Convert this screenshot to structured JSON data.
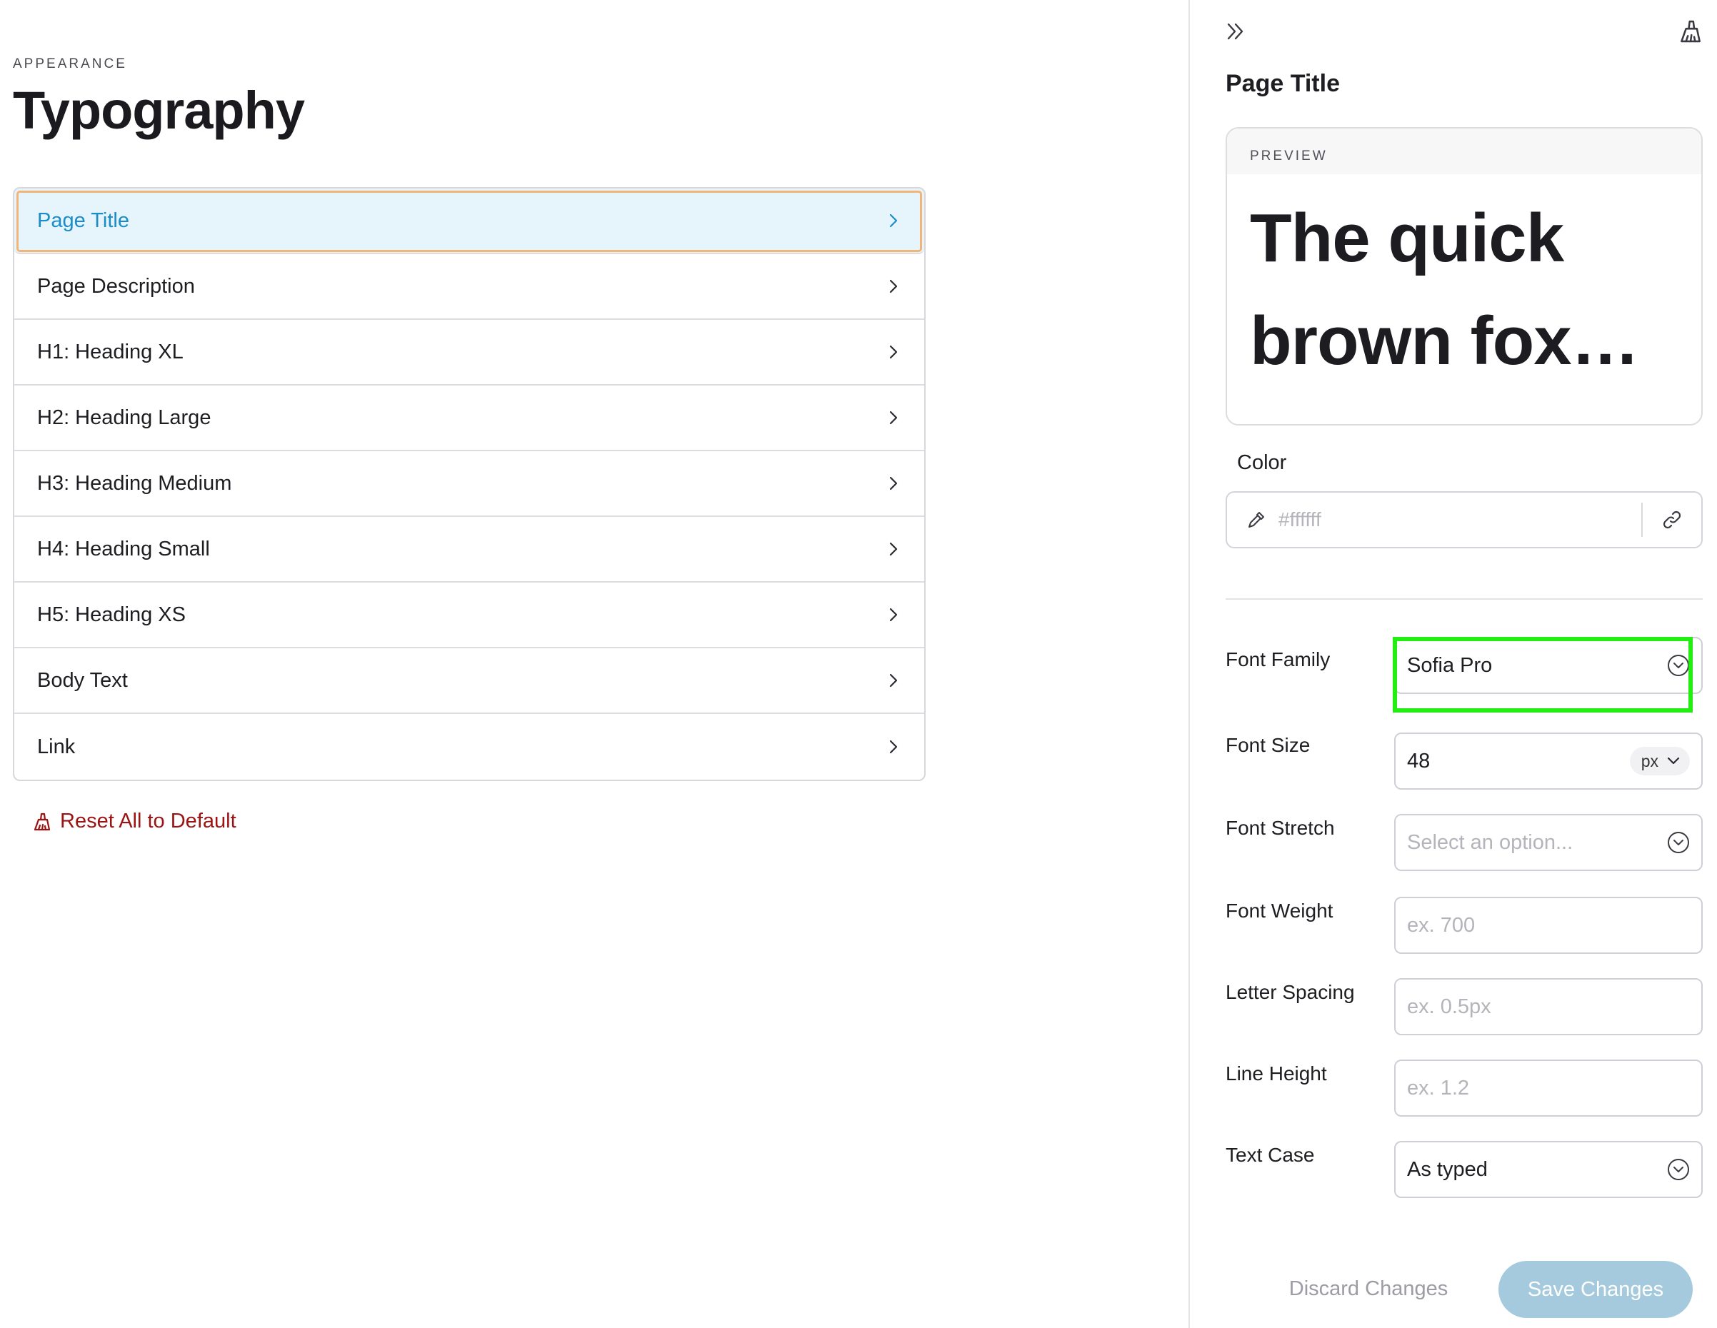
{
  "header": {
    "eyebrow": "APPEARANCE",
    "title": "Typography"
  },
  "type_list": {
    "selected_index": 0,
    "items": [
      {
        "label": "Page Title"
      },
      {
        "label": "Page Description"
      },
      {
        "label": "H1: Heading XL"
      },
      {
        "label": "H2: Heading Large"
      },
      {
        "label": "H3: Heading Medium"
      },
      {
        "label": "H4: Heading Small"
      },
      {
        "label": "H5: Heading XS"
      },
      {
        "label": "Body Text"
      },
      {
        "label": "Link"
      }
    ]
  },
  "reset": {
    "label": "Reset All to Default",
    "icon": "brush-icon",
    "color": "#9b1414"
  },
  "panel": {
    "title": "Page Title",
    "preview": {
      "label": "PREVIEW",
      "text": "The quick brown fox…"
    },
    "color": {
      "label": "Color",
      "placeholder": "#ffffff",
      "value": ""
    },
    "properties": {
      "font_family": {
        "label": "Font Family",
        "value": "Sofia Pro"
      },
      "font_size": {
        "label": "Font Size",
        "value": "48",
        "unit": "px"
      },
      "font_stretch": {
        "label": "Font Stretch",
        "placeholder": "Select an option..."
      },
      "font_weight": {
        "label": "Font Weight",
        "placeholder": "ex. 700"
      },
      "letter_spacing": {
        "label": "Letter Spacing",
        "placeholder": "ex. 0.5px"
      },
      "line_height": {
        "label": "Line Height",
        "placeholder": "ex. 1.2"
      },
      "text_case": {
        "label": "Text Case",
        "value": "As typed"
      }
    },
    "actions": {
      "discard_label": "Discard Changes",
      "save_label": "Save Changes"
    }
  },
  "colors": {
    "accent": "#1a8cc8",
    "selected_bg": "#e6f5fb",
    "selected_outline": "#f0b577",
    "highlight": "#22ee11",
    "save_button": "#a5cadd"
  }
}
